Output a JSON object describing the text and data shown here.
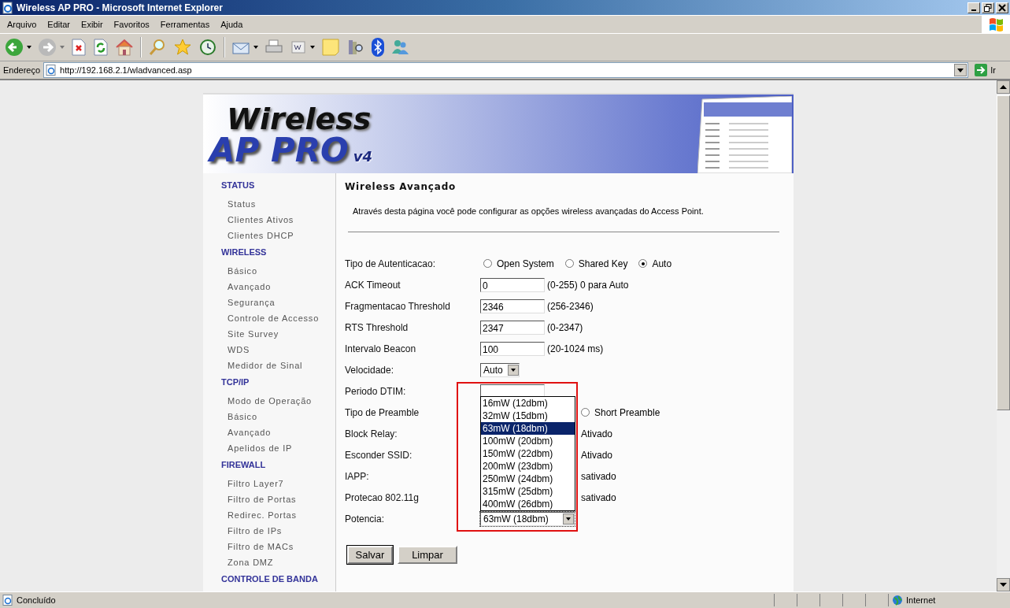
{
  "window": {
    "title": "Wireless AP PRO - Microsoft Internet Explorer"
  },
  "menu": [
    "Arquivo",
    "Editar",
    "Exibir",
    "Favoritos",
    "Ferramentas",
    "Ajuda"
  ],
  "address": {
    "label": "Endereço",
    "url": "http://192.168.2.1/wladvanced.asp",
    "go": "Ir"
  },
  "banner": {
    "line1": "Wireless",
    "line2": "AP PRO",
    "version": "v4"
  },
  "sidebar": [
    {
      "heading": "STATUS",
      "items": [
        "Status",
        "Clientes Ativos",
        "Clientes DHCP"
      ]
    },
    {
      "heading": "WIRELESS",
      "items": [
        "Básico",
        "Avançado",
        "Segurança",
        "Controle de Accesso",
        "Site Survey",
        "WDS",
        "Medidor de Sinal"
      ]
    },
    {
      "heading": "TCP/IP",
      "items": [
        "Modo de Operação",
        "Básico",
        "Avançado",
        "Apelidos de IP"
      ]
    },
    {
      "heading": "FIREWALL",
      "items": [
        "Filtro Layer7",
        "Filtro de Portas",
        "Redirec. Portas",
        "Filtro de IPs",
        "Filtro de MACs",
        "Zona DMZ"
      ]
    },
    {
      "heading": "CONTROLE DE BANDA"
    }
  ],
  "page": {
    "title": "Wireless Avançado",
    "description": "Através desta página você pode configurar as opções wireless avançadas do Access Point."
  },
  "form": [
    {
      "label": "Tipo de Autenticacao:",
      "kind": "radio",
      "options": [
        {
          "label": "Open System",
          "selected": false
        },
        {
          "label": "Shared Key",
          "selected": false
        },
        {
          "label": "Auto",
          "selected": true
        }
      ]
    },
    {
      "label": "ACK Timeout",
      "kind": "text",
      "value": "0",
      "hint": "(0-255) 0 para Auto"
    },
    {
      "label": "Fragmentacao Threshold",
      "kind": "text",
      "value": "2346",
      "hint": "(256-2346)"
    },
    {
      "label": "RTS Threshold",
      "kind": "text",
      "value": "2347",
      "hint": "(0-2347)"
    },
    {
      "label": "Intervalo Beacon",
      "kind": "text",
      "value": "100",
      "hint": "(20-1024 ms)"
    },
    {
      "label": "Velocidade:",
      "kind": "select",
      "value": "Auto",
      "open": false
    },
    {
      "label": "Periodo DTIM:",
      "kind": "text"
    },
    {
      "label": "Tipo de Preamble",
      "kind": "partial",
      "options": [
        {
          "label": "Short Preamble",
          "selected": false
        }
      ]
    },
    {
      "label": "Block Relay:",
      "kind": "partial",
      "text": "Ativado"
    },
    {
      "label": "Esconder SSID:",
      "kind": "partial",
      "text": "Ativado"
    },
    {
      "label": "IAPP:",
      "kind": "partial",
      "text": "sativado"
    },
    {
      "label": "Protecao 802.11g",
      "kind": "partial",
      "text": "sativado"
    },
    {
      "label": "Potencia:",
      "kind": "select",
      "value": "63mW (18dbm)",
      "open": true,
      "options": [
        {
          "label": "16mW (12dbm)",
          "selected": false
        },
        {
          "label": "32mW (15dbm)",
          "selected": false
        },
        {
          "label": "63mW (18dbm)",
          "selected": true
        },
        {
          "label": "100mW (20dbm)",
          "selected": false
        },
        {
          "label": "150mW (22dbm)",
          "selected": false
        },
        {
          "label": "200mW (23dbm)",
          "selected": false
        },
        {
          "label": "250mW (24dbm)",
          "selected": false
        },
        {
          "label": "315mW (25dbm)",
          "selected": false
        },
        {
          "label": "400mW (26dbm)",
          "selected": false
        }
      ]
    }
  ],
  "buttons": [
    {
      "label": "Salvar",
      "focused": true
    },
    {
      "label": "Limpar",
      "focused": false
    }
  ],
  "status": {
    "text": "Concluído",
    "zone": "Internet"
  }
}
